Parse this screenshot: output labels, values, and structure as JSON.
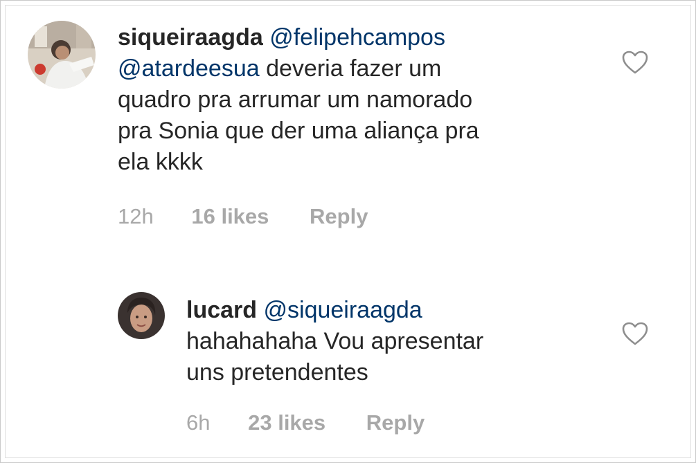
{
  "comments": [
    {
      "username": "siqueiraagda",
      "text_parts": [
        "@felipehcampos",
        "@atardeesua",
        "deveria fazer um",
        "quadro pra arrumar um namorado",
        "pra Sonia que der uma aliança pra",
        "ela kkkk"
      ],
      "time": "12h",
      "likes": "16 likes",
      "reply_label": "Reply"
    },
    {
      "username": "lucard",
      "text_parts": [
        "@siqueiraagda",
        "hahahahaha Vou apresentar",
        "uns pretendentes"
      ],
      "time": "6h",
      "likes": "23 likes",
      "reply_label": "Reply"
    }
  ],
  "colors": {
    "text": "#262626",
    "mention": "#003569",
    "meta": "#a8a8a8"
  },
  "icons": {
    "like": "heart-outline-icon"
  }
}
